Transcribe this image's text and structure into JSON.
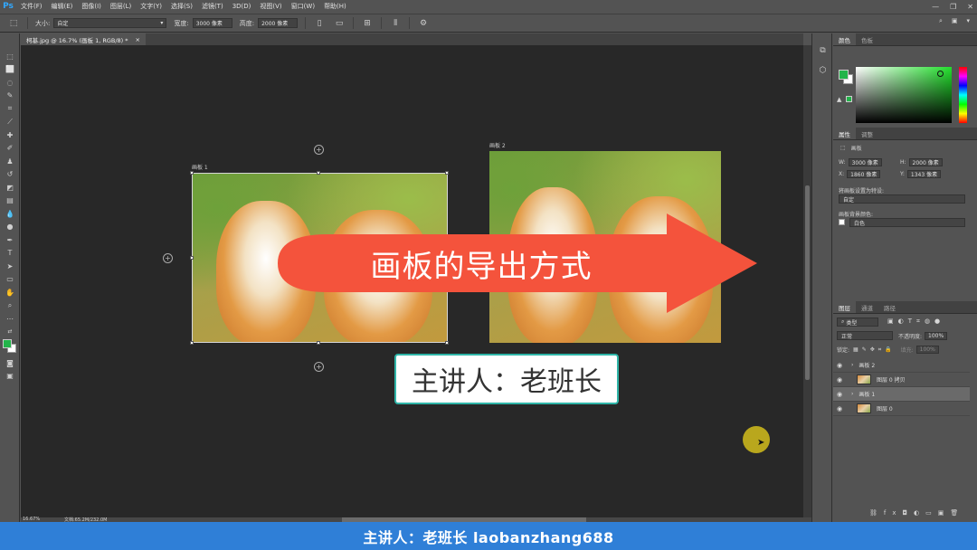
{
  "app": {
    "logo": "Ps",
    "menu": [
      "文件(F)",
      "编辑(E)",
      "图像(I)",
      "图层(L)",
      "文字(Y)",
      "选择(S)",
      "滤镜(T)",
      "3D(D)",
      "视图(V)",
      "窗口(W)",
      "帮助(H)"
    ]
  },
  "options": {
    "size_label": "大小:",
    "size_value": "自定",
    "width_label": "宽度:",
    "width_value": "3000 像素",
    "height_label": "高度:",
    "height_value": "2000 像素"
  },
  "document": {
    "tab_title": "柯基.jpg @ 16.7% (画板 1, RGB/8) *",
    "zoom": "16.67%",
    "doc_info": "文档:65.2M/232.0M",
    "artboard1_label": "画板 1",
    "artboard2_label": "画板 2"
  },
  "overlay": {
    "arrow_text": "画板的导出方式",
    "presenter_text": "主讲人：老班长",
    "arrow_color": "#f4533c"
  },
  "panels": {
    "color_tabs": [
      "颜色",
      "色板"
    ],
    "props_tabs": [
      "属性",
      "调整"
    ],
    "props_title": "画板",
    "w_label": "W:",
    "w_value": "3000 像素",
    "h_label": "H:",
    "h_value": "2000 像素",
    "x_label": "X:",
    "x_value": "1860 像素",
    "y_label": "Y:",
    "y_value": "1343 像素",
    "preset_label": "将画板设置为特设:",
    "preset_value": "自定",
    "bg_label": "画板背景颜色:",
    "bg_value": "白色",
    "layers_tabs": [
      "图层",
      "通道",
      "路径"
    ],
    "filter_value": "类型",
    "blend_value": "正常",
    "opacity_label": "不透明度:",
    "opacity_value": "100%",
    "lock_label": "锁定:",
    "fill_label": "填充:",
    "fill_value": "100%",
    "layers": [
      {
        "name": "画板 2",
        "type": "artboard"
      },
      {
        "name": "图层 0 拷贝",
        "type": "layer"
      },
      {
        "name": "画板 1",
        "type": "artboard",
        "selected": true
      },
      {
        "name": "图层 0",
        "type": "layer"
      }
    ]
  },
  "subtitle": "主讲人：老班长 laobanzhang688",
  "colors": {
    "foreground": "#22b44a",
    "background": "#ffffff",
    "subtitle_bar": "#2f7fd7",
    "presenter_border": "#2fb5a8"
  }
}
